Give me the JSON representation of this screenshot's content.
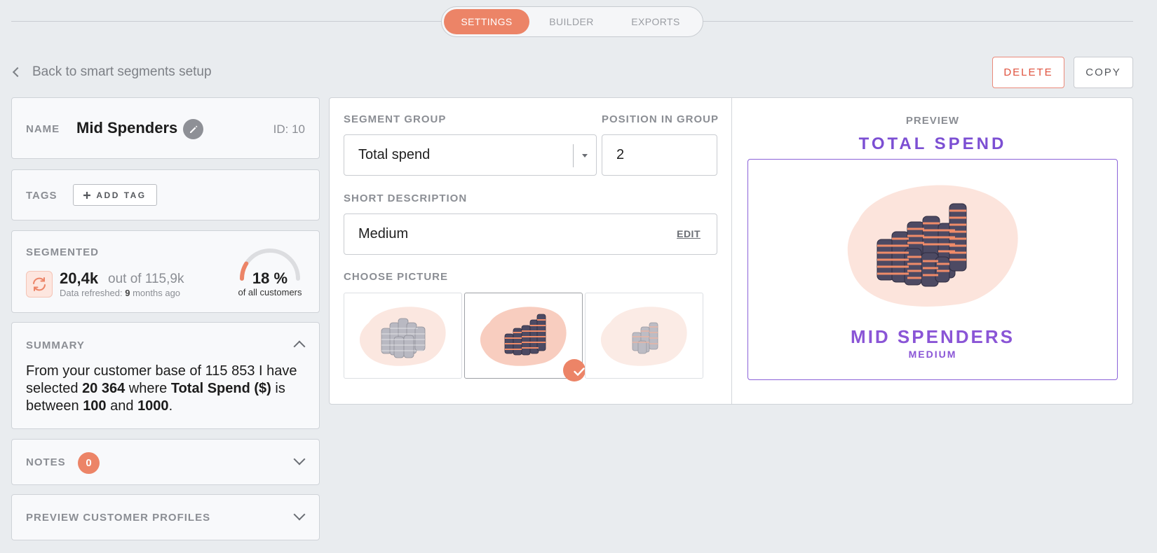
{
  "tabs": [
    {
      "label": "SETTINGS",
      "active": true
    },
    {
      "label": "BUILDER",
      "active": false
    },
    {
      "label": "EXPORTS",
      "active": false
    }
  ],
  "back_link": "Back to smart segments setup",
  "actions": {
    "delete": "DELETE",
    "copy": "COPY"
  },
  "name_card": {
    "label": "NAME",
    "value": "Mid Spenders",
    "id": "ID: 10"
  },
  "tags_card": {
    "label": "TAGS",
    "add_tag": "ADD TAG"
  },
  "segmented": {
    "label": "SEGMENTED",
    "count": "20,4k",
    "out_of": "out of 115,9k",
    "refreshed_prefix": "Data refreshed:",
    "refreshed_value": "9",
    "refreshed_suffix": "months ago",
    "percent": "18 %",
    "percent_fraction": 0.18,
    "percent_sub": "of all customers"
  },
  "summary": {
    "label": "SUMMARY",
    "t1": "From your customer base of 115 853 I have selected",
    "n1": "20 364",
    "t2": "where",
    "field": "Total Spend ($)",
    "t3": "is between",
    "min": "100",
    "t4": "and",
    "max": "1000",
    "t5": "."
  },
  "notes": {
    "label": "NOTES",
    "count": "0"
  },
  "preview_profiles": {
    "label": "PREVIEW CUSTOMER PROFILES"
  },
  "form": {
    "segment_group_label": "SEGMENT GROUP",
    "segment_group_value": "Total spend",
    "position_label": "POSITION IN GROUP",
    "position_value": "2",
    "short_desc_label": "SHORT DESCRIPTION",
    "short_desc_value": "Medium",
    "edit": "EDIT",
    "choose_picture_label": "CHOOSE PICTURE",
    "pictures": [
      {
        "name": "coins-small-gray",
        "selected": false
      },
      {
        "name": "coins-medium-color",
        "selected": true
      },
      {
        "name": "coins-few-gray",
        "selected": false
      }
    ]
  },
  "preview": {
    "label": "PREVIEW",
    "group": "TOTAL SPEND",
    "segment_name": "MID SPENDERS",
    "segment_sub": "MEDIUM"
  },
  "colors": {
    "accent": "#ec8467",
    "purple": "#7c4fd3",
    "delete": "#e0533f",
    "background": "#e9ecef"
  }
}
